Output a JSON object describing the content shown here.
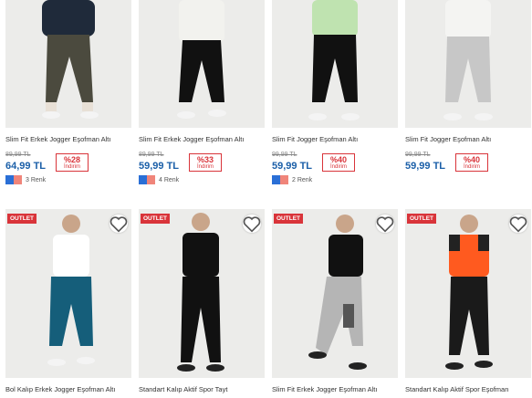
{
  "products_row1": [
    {
      "title": "Slim Fit Erkek Jogger Eşofman Altı",
      "old_price": "89,99 TL",
      "price": "64,99 TL",
      "discount": "%28",
      "discount_label": "İndirim",
      "colors_label": "3 Renk",
      "shirt": "#1f2a3a",
      "pants": "#4b4a3e"
    },
    {
      "title": "Slim Fit Erkek Jogger Eşofman Altı",
      "old_price": "89,99 TL",
      "price": "59,99 TL",
      "discount": "%33",
      "discount_label": "İndirim",
      "colors_label": "4 Renk",
      "shirt": "#f2f2ee",
      "pants": "#111111"
    },
    {
      "title": "Slim Fit Jogger Eşofman Altı",
      "old_price": "99,99 TL",
      "price": "59,99 TL",
      "discount": "%40",
      "discount_label": "İndirim",
      "colors_label": "2 Renk",
      "shirt": "#bfe3b0",
      "pants": "#111111"
    },
    {
      "title": "Slim Fit Jogger Eşofman Altı",
      "old_price": "99,99 TL",
      "price": "59,99 TL",
      "discount": "%40",
      "discount_label": "İndirim",
      "colors_label": "",
      "shirt": "#f4f4f2",
      "pants": "#c7c7c7"
    }
  ],
  "products_row2": [
    {
      "title": "Bol Kalıp Erkek Jogger Eşofman Altı",
      "badge": "OUTLET",
      "shirt": "#ffffff",
      "pants": "#155e7a"
    },
    {
      "title": "Standart Kalıp Aktif Spor Tayt",
      "badge": "OUTLET",
      "shirt": "#111111",
      "pants": "#111111"
    },
    {
      "title": "Slim Fit Erkek Jogger Eşofman Altı",
      "badge": "OUTLET",
      "shirt": "#111111",
      "pants": "#b5b5b5"
    },
    {
      "title": "Standart Kalıp Aktif Spor Eşofman",
      "badge": "OUTLET",
      "shirt": "#ff5a1f",
      "pants": "#1a1a1a"
    }
  ],
  "swatch_colors": {
    "a": "#2a6fd6",
    "b": "#f0857a"
  }
}
